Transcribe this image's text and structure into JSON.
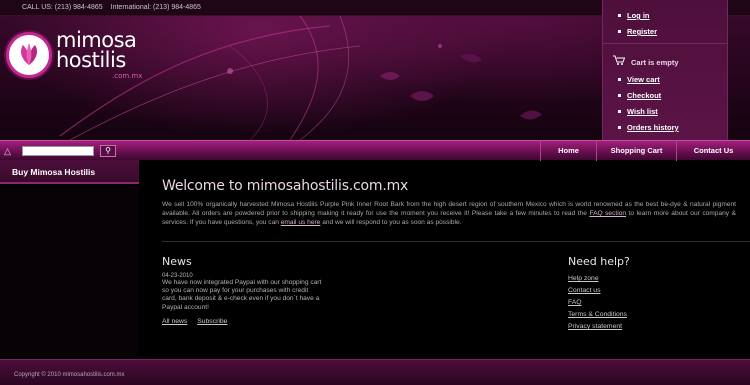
{
  "topbar": {
    "call_us": "CALL US: (213) 984-4865",
    "international": "International: (213) 984-4865"
  },
  "logo": {
    "line1": "mimosa",
    "line2": "hostilis",
    "domain": ".com.mx",
    "icon": "leaf-icon"
  },
  "user_panel": {
    "login": "Log in",
    "register": "Register",
    "cart_status": "Cart is empty",
    "cart_icon": "shopping-cart-icon",
    "view_cart": "View cart",
    "checkout": "Checkout",
    "wish_list": "Wish list",
    "orders_history": "Orders history"
  },
  "search": {
    "icon": "binoculars-icon",
    "placeholder": "",
    "button_icon": "search-icon"
  },
  "nav": {
    "home": "Home",
    "shopping_cart": "Shopping Cart",
    "contact_us": "Contact Us"
  },
  "sidebar": {
    "items": [
      {
        "label": "Buy Mimosa Hostilis"
      }
    ]
  },
  "main": {
    "title": "Welcome to mimosahostilis.com.mx",
    "intro_part1": "We sell 100% organically harvested Mimosa Hostilis Purple Pink Inner Root Bark from the high desert region of southern Mexico which is world renowned as the best be-dye & natural pigment available. All orders are powdered prior to shipping making it ready for use the moment you receive it! Please take a few minutes to read the ",
    "intro_link1": "FAQ section",
    "intro_part2": " to learn more about our company & services. If you have questions, you can ",
    "intro_link2": "email us here",
    "intro_part3": " and we will respond to you as soon as possible."
  },
  "news": {
    "heading": "News",
    "date": "04-23-2010",
    "text": "We have now integrated Paypal with our shopping cart so you can now pay for your purchases with credit card, bank deposit & e-check even if you don´t have a Paypal account!",
    "all_news": "All news",
    "subscribe": "Subscribe"
  },
  "help": {
    "heading": "Need help?",
    "links": [
      "Help zone",
      "Contact us",
      "FAQ",
      "Terms & Conditions",
      "Privacy statement"
    ]
  },
  "footer": {
    "copyright": "Copyright © 2010 mimosahostilis.com.mx"
  },
  "colors": {
    "brand": "#c2288f",
    "nav_bar": "#8a1a6a",
    "panel": "#551240"
  }
}
